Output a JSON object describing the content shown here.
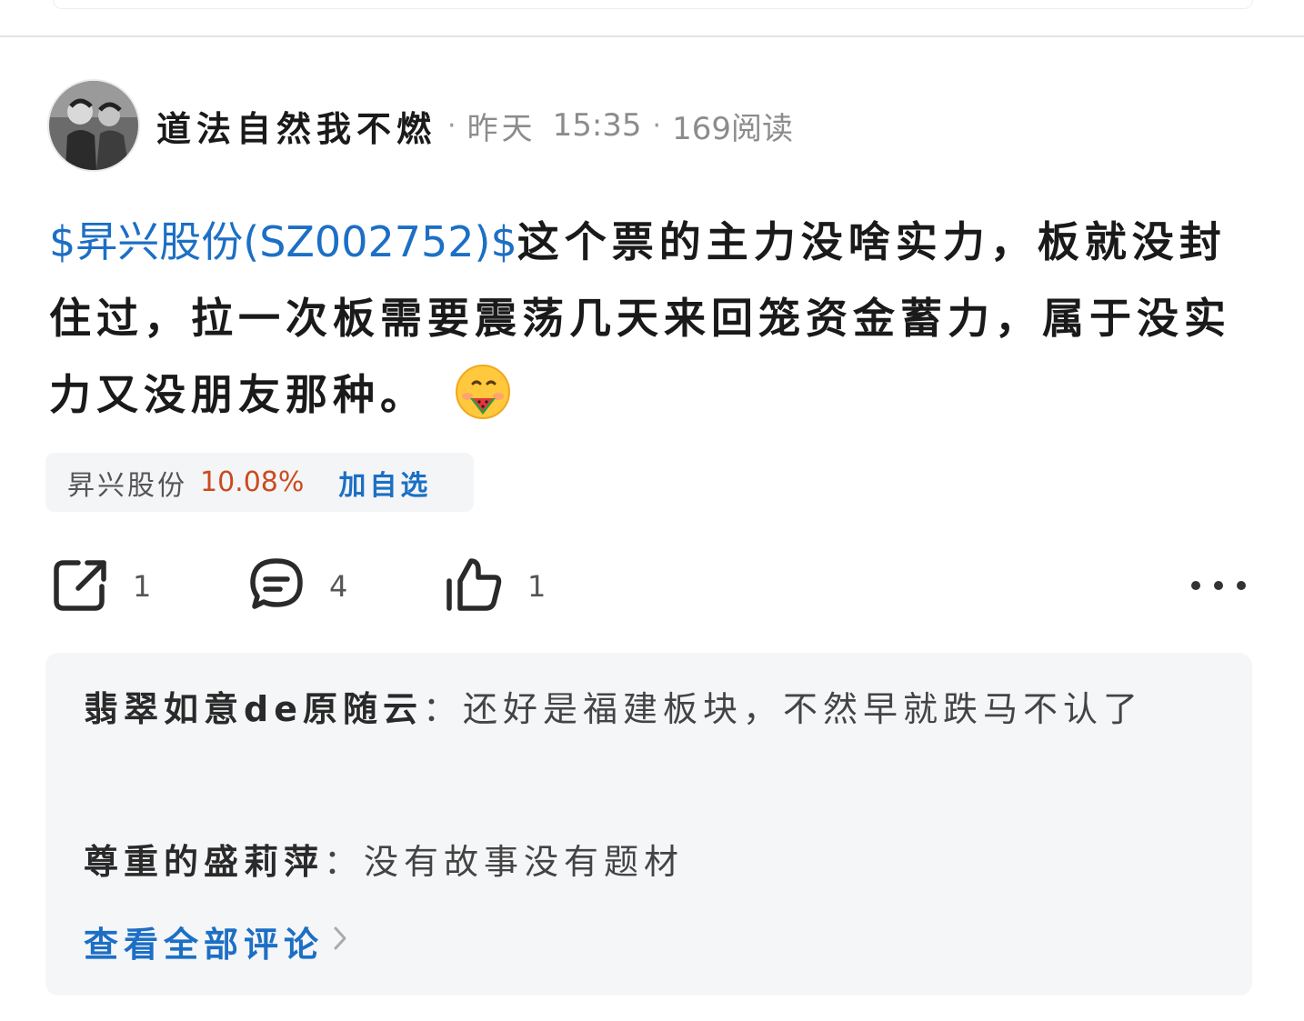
{
  "post": {
    "author": "道法自然我不燃",
    "date": "昨天",
    "time": "15:35",
    "reads": "169阅读",
    "stock_tag": "$昇兴股份(SZ002752)$",
    "body_text": "这个票的主力没啥实力，板就没封住过，拉一次板需要震荡几天来回笼资金蓄力，属于没实力又没朋友那种。"
  },
  "stock_chip": {
    "name": "昇兴股份",
    "change": "10.08%",
    "add_label": "加自选",
    "colors": {
      "up": "#cc4a1e",
      "link": "#1c6fc4"
    }
  },
  "actions": {
    "share_count": "1",
    "comment_count": "4",
    "like_count": "1",
    "icons": [
      "share-icon",
      "comment-icon",
      "thumbs-up-icon",
      "more-icon"
    ]
  },
  "comments": [
    {
      "user": "翡翠如意de原随云",
      "text": "还好是福建板块，不然早就跌马不认了"
    },
    {
      "user": "尊重的盛莉萍",
      "text": "没有故事没有题材"
    }
  ],
  "view_all_label": "查看全部评论",
  "emoji": "watermelon-face-emoji"
}
